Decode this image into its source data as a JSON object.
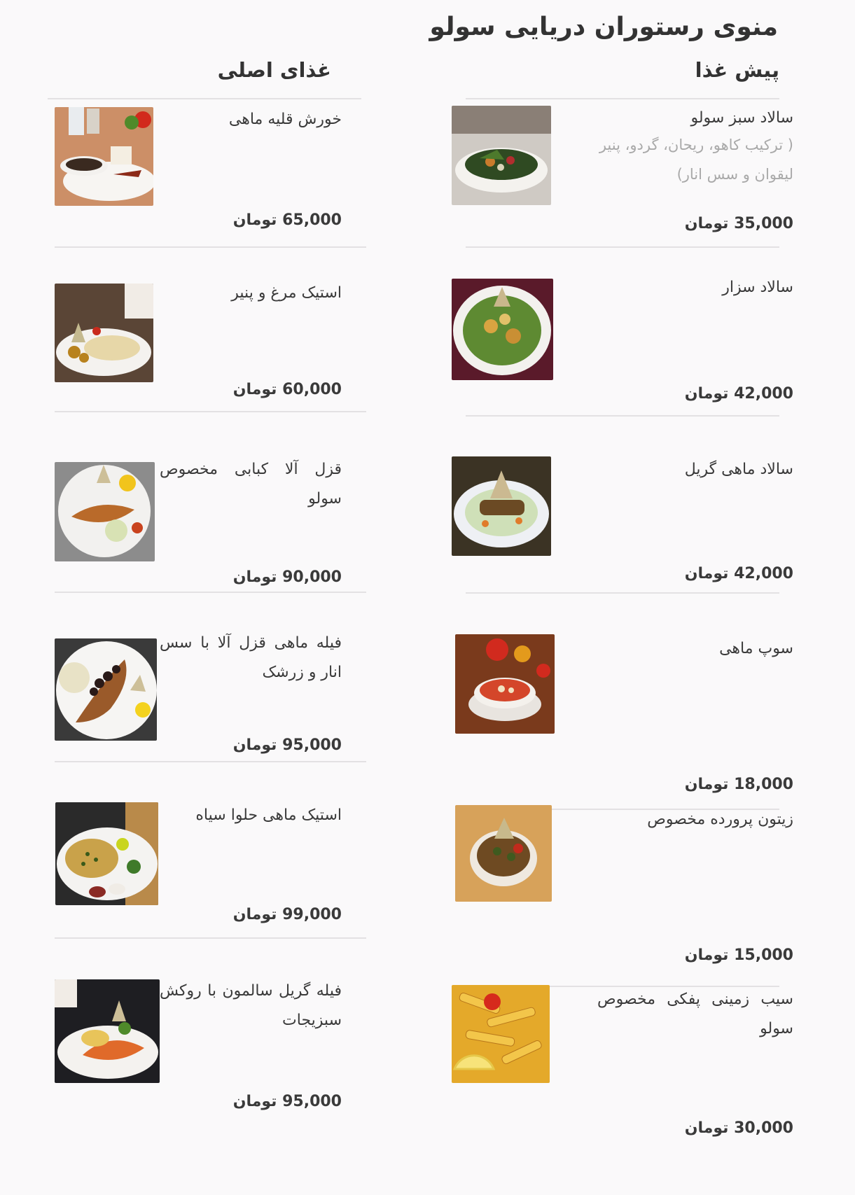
{
  "page_title": "منوی رستوران دریایی سولو",
  "columns": {
    "appetizers": {
      "heading": "پیش غذا",
      "items": [
        {
          "name": "سالاد سبز سولو",
          "desc": "( ترکیب کاهو، ریحان، گردو، پنیر لیقوان و سس انار)",
          "price": "35,000 تومان",
          "photo_icon": "green-salad-photo"
        },
        {
          "name": "سالاد سزار",
          "desc": "",
          "price": "42,000 تومان",
          "photo_icon": "caesar-salad-photo"
        },
        {
          "name": "سالاد ماهی گریل",
          "desc": "",
          "price": "42,000 تومان",
          "photo_icon": "grilled-fish-salad-photo"
        },
        {
          "name": "سوپ ماهی",
          "desc": "",
          "price": "18,000 تومان",
          "photo_icon": "fish-soup-photo"
        },
        {
          "name": "زیتون پرورده مخصوص",
          "desc": "",
          "price": "15,000 تومان",
          "photo_icon": "olive-photo"
        },
        {
          "name": "سیب زمینی پفکی مخصوص سولو",
          "desc": "",
          "price": "30,000 تومان",
          "photo_icon": "fries-photo"
        }
      ]
    },
    "mains": {
      "heading": "غذای اصلی",
      "items": [
        {
          "name": "خورش قلیه ماهی",
          "price": "65,000 تومان",
          "photo_icon": "fish-stew-photo"
        },
        {
          "name": "استیک مرغ و پنیر",
          "price": "60,000 تومان",
          "photo_icon": "chicken-steak-photo"
        },
        {
          "name": "قزل آلا کبابی مخصوص سولو",
          "price": "90,000 تومان",
          "photo_icon": "grilled-trout-photo"
        },
        {
          "name": "فیله ماهی قزل آلا با سس انار و زرشک",
          "price": "95,000 تومان",
          "photo_icon": "trout-fillet-photo"
        },
        {
          "name": "استیک ماهی حلوا سیاه",
          "price": "99,000 تومان",
          "photo_icon": "pomfret-steak-photo"
        },
        {
          "name": "فیله گریل سالمون با روکش سبزیجات",
          "price": "95,000 تومان",
          "photo_icon": "salmon-fillet-photo"
        }
      ]
    }
  },
  "colors": {
    "background": "#faf9fa",
    "text": "#3a3a3a",
    "muted": "#a9a9a9",
    "rule": "#e3e1e3"
  }
}
